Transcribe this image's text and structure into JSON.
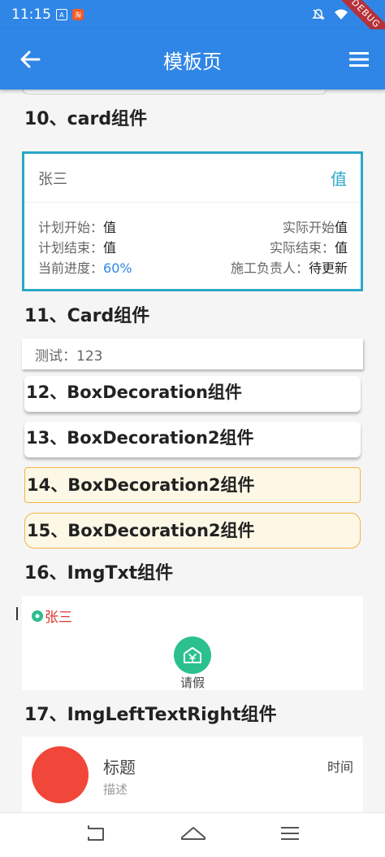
{
  "status_bar": {
    "time": "11:15",
    "debug_label": "DEBUG"
  },
  "app_bar": {
    "title": "模板页"
  },
  "sections": {
    "s10": "10、card组件",
    "s11": "11、Card组件",
    "s12": "12、BoxDecoration组件",
    "s13": "13、BoxDecoration2组件",
    "s14": "14、BoxDecoration2组件",
    "s15": "15、BoxDecoration2组件",
    "s16": "16、ImgTxt组件",
    "s17": "17、ImgLeftTextRight组件"
  },
  "card10": {
    "name": "张三",
    "value": "值",
    "plan_start_label": "计划开始：",
    "plan_start_value": "值",
    "actual_start_label": "实际开始",
    "actual_start_value": "值",
    "plan_end_label": "计划结束：",
    "plan_end_value": "值",
    "actual_end_label": "实际结束：",
    "actual_end_value": "值",
    "progress_label": "当前进度：",
    "progress_value": "60%",
    "owner_label": "施工负责人：",
    "owner_value": "待更新"
  },
  "card11": {
    "text": "测试：123"
  },
  "imgtxt": {
    "name": "张三",
    "label": "请假"
  },
  "imglr": {
    "title": "标题",
    "desc": "描述",
    "time": "时间"
  },
  "colors": {
    "primary": "#2f86e6",
    "card_border": "#2aa8c6",
    "deco_border": "#f2b54a",
    "deco_bg": "#fdf8e6",
    "accent_green": "#2bc08e",
    "name_red": "#d8382c",
    "avatar_red": "#f0473a"
  },
  "icons": [
    "back-arrow-icon",
    "menu-icon",
    "wifi-icon",
    "mute-icon",
    "yen-house-icon",
    "nav-back-icon",
    "nav-home-icon",
    "nav-recents-icon"
  ]
}
